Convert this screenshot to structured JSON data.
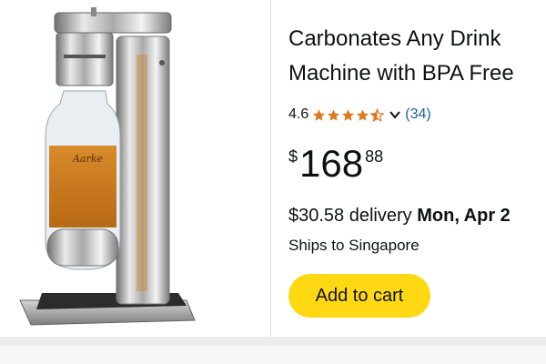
{
  "product": {
    "title_line_1": "Carbonates Any Drink",
    "title_line_2": "Machine with BPA Free",
    "rating": "4.6",
    "stars_filled": 4.5,
    "stars_total": 5,
    "review_count": "(34)",
    "price": {
      "symbol": "$",
      "whole": "168",
      "fraction": "88"
    },
    "delivery": {
      "fee": "$30.58 delivery",
      "date": "Mon, Apr 2"
    },
    "ships_to": "Ships to Singapore",
    "add_to_cart_label": "Add to cart",
    "image_label": "soda maker with bottle",
    "bottle_brand_text": "Aarke"
  },
  "colors": {
    "star": "#de7921",
    "link": "#2162a1",
    "button": "#ffd814",
    "text": "#0f1111"
  },
  "icons": {
    "rating_dropdown": "chevron-down-icon",
    "star": "star-icon"
  }
}
